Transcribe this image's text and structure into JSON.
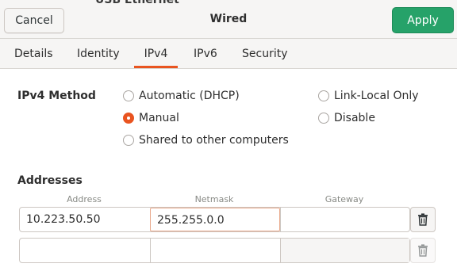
{
  "header": {
    "behind_text": "USB Ethernet",
    "cancel_label": "Cancel",
    "title": "Wired",
    "apply_label": "Apply",
    "apply_color": "#26a269"
  },
  "tabs": [
    {
      "label": "Details",
      "active": false
    },
    {
      "label": "Identity",
      "active": false
    },
    {
      "label": "IPv4",
      "active": true
    },
    {
      "label": "IPv6",
      "active": false
    },
    {
      "label": "Security",
      "active": false
    }
  ],
  "accent_color": "#e95420",
  "ipv4_method": {
    "label": "IPv4 Method",
    "selected": "Manual",
    "options": [
      "Automatic (DHCP)",
      "Manual",
      "Shared to other computers",
      "Link-Local Only",
      "Disable"
    ]
  },
  "addresses": {
    "label": "Addresses",
    "columns": [
      "Address",
      "Netmask",
      "Gateway"
    ],
    "rows": [
      {
        "address": "10.223.50.50",
        "netmask": "255.255.0.0",
        "gateway": ""
      },
      {
        "address": "",
        "netmask": "",
        "gateway": ""
      }
    ],
    "delete_icon": "trash-icon"
  }
}
